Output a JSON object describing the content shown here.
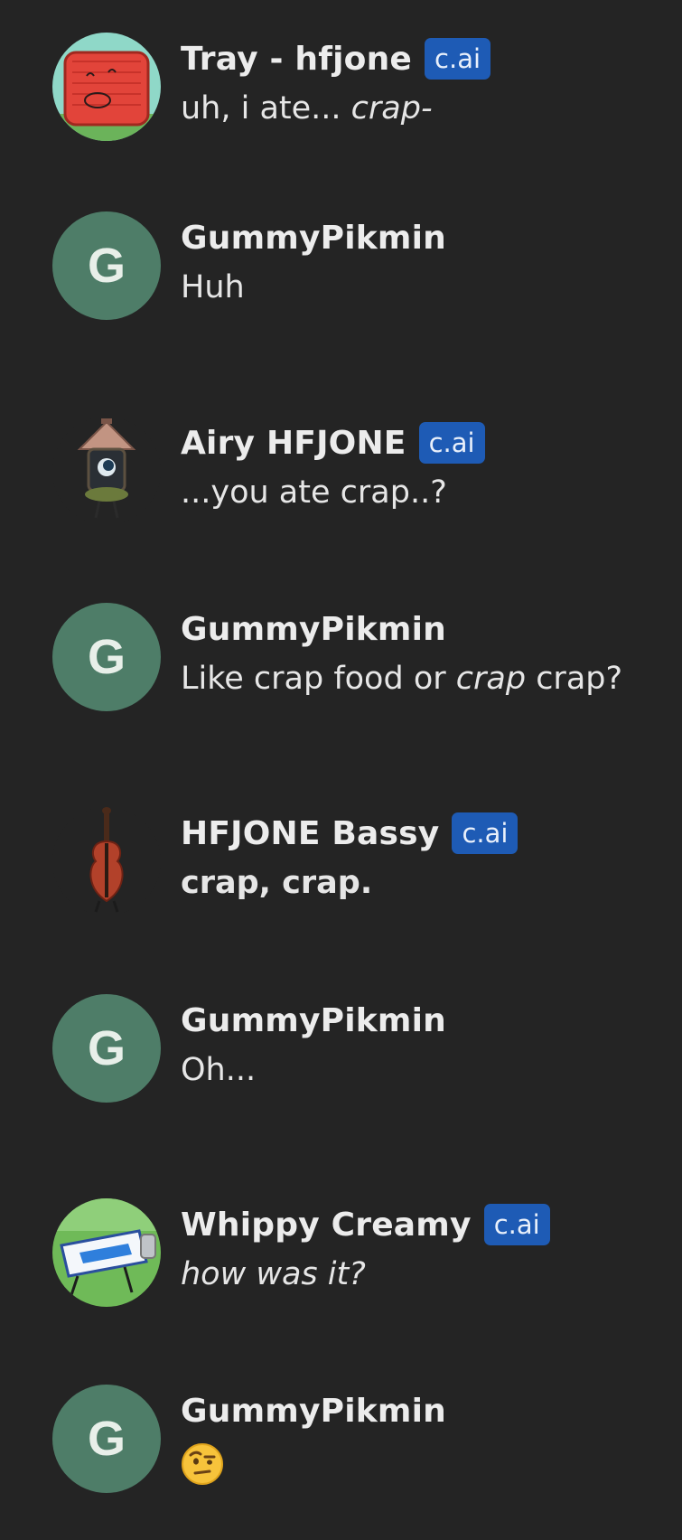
{
  "messages": [
    {
      "author": "Tray - hfjone",
      "badge": "c.ai",
      "avatar_icon": "red-tray-character-icon",
      "text_parts": [
        {
          "text": "uh, i ate... ",
          "style": "normal"
        },
        {
          "text": "crap-",
          "style": "italic"
        }
      ]
    },
    {
      "author": "GummyPikmin",
      "avatar_letter": "G",
      "text_parts": [
        {
          "text": "Huh",
          "style": "normal"
        }
      ]
    },
    {
      "author": "Airy HFJONE",
      "badge": "c.ai",
      "avatar_icon": "lantern-character-icon",
      "text_parts": [
        {
          "text": "...you ate crap..?",
          "style": "normal"
        }
      ]
    },
    {
      "author": "GummyPikmin",
      "avatar_letter": "G",
      "text_parts": [
        {
          "text": "Like crap food or ",
          "style": "normal"
        },
        {
          "text": "crap",
          "style": "italic"
        },
        {
          "text": " crap?",
          "style": "normal"
        }
      ]
    },
    {
      "author": "HFJONE Bassy",
      "badge": "c.ai",
      "avatar_icon": "cello-character-icon",
      "text_parts": [
        {
          "text": "crap, crap.",
          "style": "bold"
        }
      ]
    },
    {
      "author": "GummyPikmin",
      "avatar_letter": "G",
      "text_parts": [
        {
          "text": "Oh...",
          "style": "normal"
        }
      ]
    },
    {
      "author": "Whippy Creamy",
      "badge": "c.ai",
      "avatar_icon": "whipped-cream-can-character-icon",
      "text_parts": [
        {
          "text": "how was it?",
          "style": "italic"
        }
      ]
    },
    {
      "author": "GummyPikmin",
      "avatar_letter": "G",
      "text_parts": [],
      "emoji_icon": "raised-eyebrow-face-icon"
    }
  ],
  "colors": {
    "background": "#242424",
    "badge": "#1e5bb5",
    "user_avatar": "#4e7d68",
    "text": "#ececec"
  }
}
